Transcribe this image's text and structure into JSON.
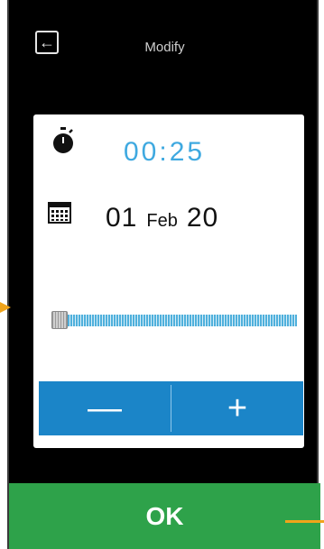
{
  "header": {
    "title": "Modify"
  },
  "timer": {
    "value": "00:25"
  },
  "date": {
    "day": "01",
    "month": "Feb",
    "year": "20"
  },
  "slider": {
    "level": 0.0
  },
  "stepper": {
    "minus_label": "—",
    "plus_label": "+"
  },
  "footer": {
    "ok_label": "OK"
  },
  "colors": {
    "accent_blue": "#1b85c8",
    "timer_blue": "#3fa9e0",
    "ok_green": "#2ea24a",
    "annotation_orange": "#f0a41a"
  }
}
